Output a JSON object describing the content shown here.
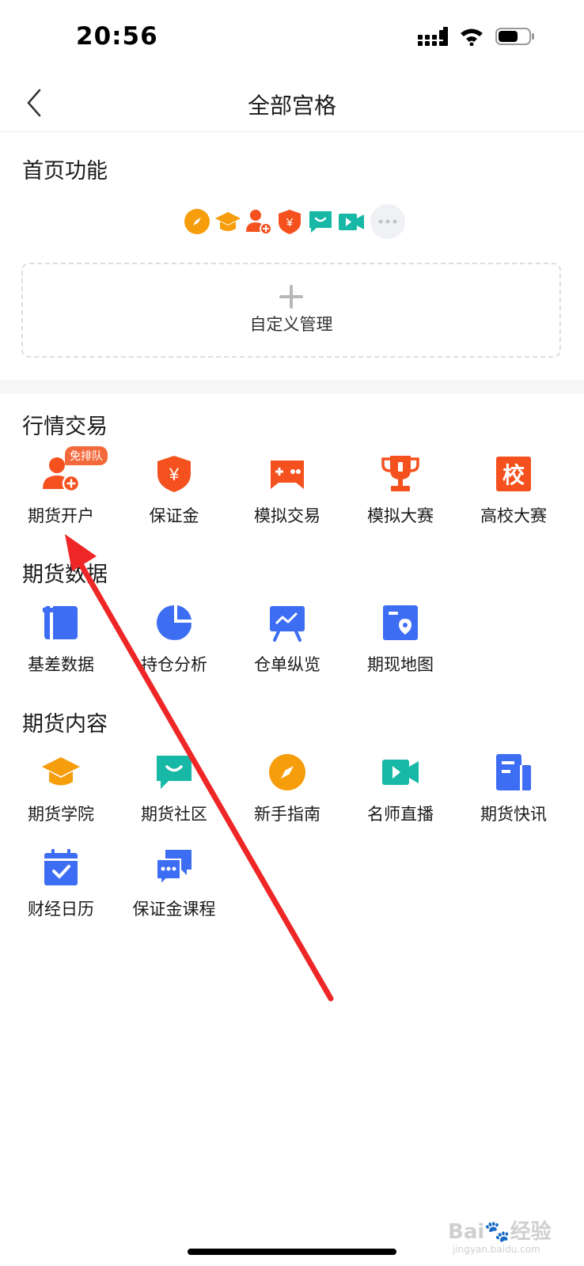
{
  "status": {
    "time": "20:56"
  },
  "header": {
    "title": "全部宫格"
  },
  "home_section": {
    "title": "首页功能",
    "icons": [
      "compass-icon",
      "graduation-cap-icon",
      "add-user-icon",
      "shield-yen-icon",
      "chat-bubble-icon",
      "video-icon",
      "more-icon"
    ],
    "custom_label": "自定义管理"
  },
  "trading": {
    "title": "行情交易",
    "items": [
      {
        "label": "期货开户",
        "icon": "add-user-icon",
        "badge": "免排队",
        "color": "#f4511e"
      },
      {
        "label": "保证金",
        "icon": "shield-yen-icon",
        "color": "#f4511e"
      },
      {
        "label": "模拟交易",
        "icon": "gamepad-icon",
        "color": "#f4511e"
      },
      {
        "label": "模拟大赛",
        "icon": "trophy-icon",
        "color": "#f4511e"
      },
      {
        "label": "高校大赛",
        "icon": "school-icon",
        "glyph": "校",
        "color": "#f4511e"
      }
    ]
  },
  "data_section": {
    "title": "期货数据",
    "items": [
      {
        "label": "基差数据",
        "icon": "basis-data-icon",
        "color": "#3d6df2"
      },
      {
        "label": "持仓分析",
        "icon": "pie-chart-icon",
        "color": "#3d6df2"
      },
      {
        "label": "仓单纵览",
        "icon": "presentation-chart-icon",
        "color": "#3d6df2"
      },
      {
        "label": "期现地图",
        "icon": "map-pin-icon",
        "color": "#3d6df2"
      }
    ]
  },
  "content_section": {
    "title": "期货内容",
    "items": [
      {
        "label": "期货学院",
        "icon": "graduation-cap-icon",
        "color": "#f59d0b"
      },
      {
        "label": "期货社区",
        "icon": "chat-bubble-icon",
        "color": "#17b8a6"
      },
      {
        "label": "新手指南",
        "icon": "compass-icon",
        "color": "#f59d0b"
      },
      {
        "label": "名师直播",
        "icon": "video-icon",
        "color": "#17b8a6"
      },
      {
        "label": "期货快讯",
        "icon": "news-icon",
        "color": "#3d6df2"
      },
      {
        "label": "财经日历",
        "icon": "calendar-check-icon",
        "color": "#3d6df2"
      },
      {
        "label": "保证金课程",
        "icon": "chat-dialog-icon",
        "color": "#3d6df2"
      }
    ]
  },
  "watermark": {
    "brand": "Bai",
    "brand2": "经验",
    "url": "jingyan.baidu.com"
  }
}
